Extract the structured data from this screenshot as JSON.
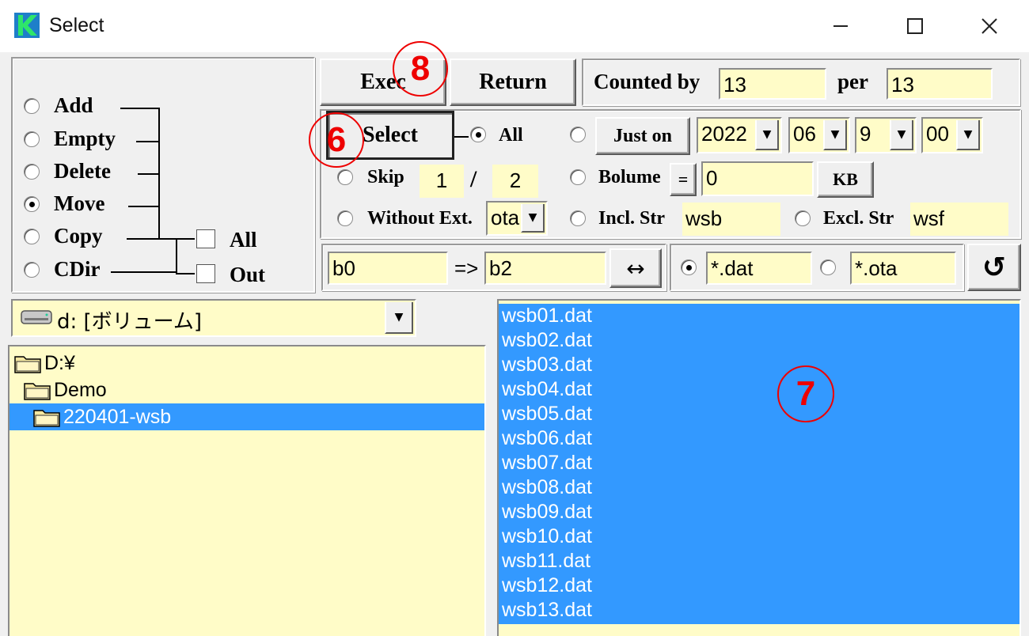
{
  "window": {
    "title": "Select"
  },
  "mode_options": [
    "Add",
    "Empty",
    "Delete",
    "Move",
    "Copy",
    "CDir"
  ],
  "mode_selected": "Move",
  "checkboxes": {
    "all_label": "All",
    "out_label": "Out"
  },
  "toolbar": {
    "exec_label": "Exec",
    "return_label": "Return",
    "select_label": "Select"
  },
  "count": {
    "counted_by_label": "Counted by",
    "counted_by_value": "13",
    "per_label": "per",
    "per_value": "13"
  },
  "select_options": {
    "all_label": "All",
    "just_on_label": "Just on",
    "year": "2022",
    "month": "06",
    "day": "9",
    "hour": "00",
    "skip_label": "Skip",
    "skip_a": "1",
    "skip_sep": "/",
    "skip_b": "2",
    "bolume_label": "Bolume",
    "eq_label": "=",
    "bolume_value": "0",
    "kb_label": "KB",
    "without_ext_label": "Without Ext.",
    "ext_value": "ota",
    "incl_label": "Incl. Str",
    "incl_value": "wsb",
    "excl_label": "Excl. Str",
    "excl_value": "wsf"
  },
  "rename": {
    "from": "b0",
    "arrow": "=>",
    "to": "b2",
    "swap_label": "↔"
  },
  "filters": {
    "pattern1": "*.dat",
    "pattern2": "*.ota",
    "refresh_label": "↺"
  },
  "drive": {
    "value": "d: [ボリューム]"
  },
  "tree": [
    {
      "label": "D:¥"
    },
    {
      "label": "Demo"
    },
    {
      "label": "220401-wsb"
    }
  ],
  "files": [
    "wsb01.dat",
    "wsb02.dat",
    "wsb03.dat",
    "wsb04.dat",
    "wsb05.dat",
    "wsb06.dat",
    "wsb07.dat",
    "wsb08.dat",
    "wsb09.dat",
    "wsb10.dat",
    "wsb11.dat",
    "wsb12.dat",
    "wsb13.dat"
  ],
  "annotations": {
    "n6": "6",
    "n7": "7",
    "n8": "8"
  },
  "colors": {
    "field_bg": "#fffcc8",
    "selection": "#3399ff",
    "annotation": "#e00000"
  },
  "icons": {
    "app": "app-icon",
    "drive": "drive-icon",
    "folder": "folder-icon"
  }
}
